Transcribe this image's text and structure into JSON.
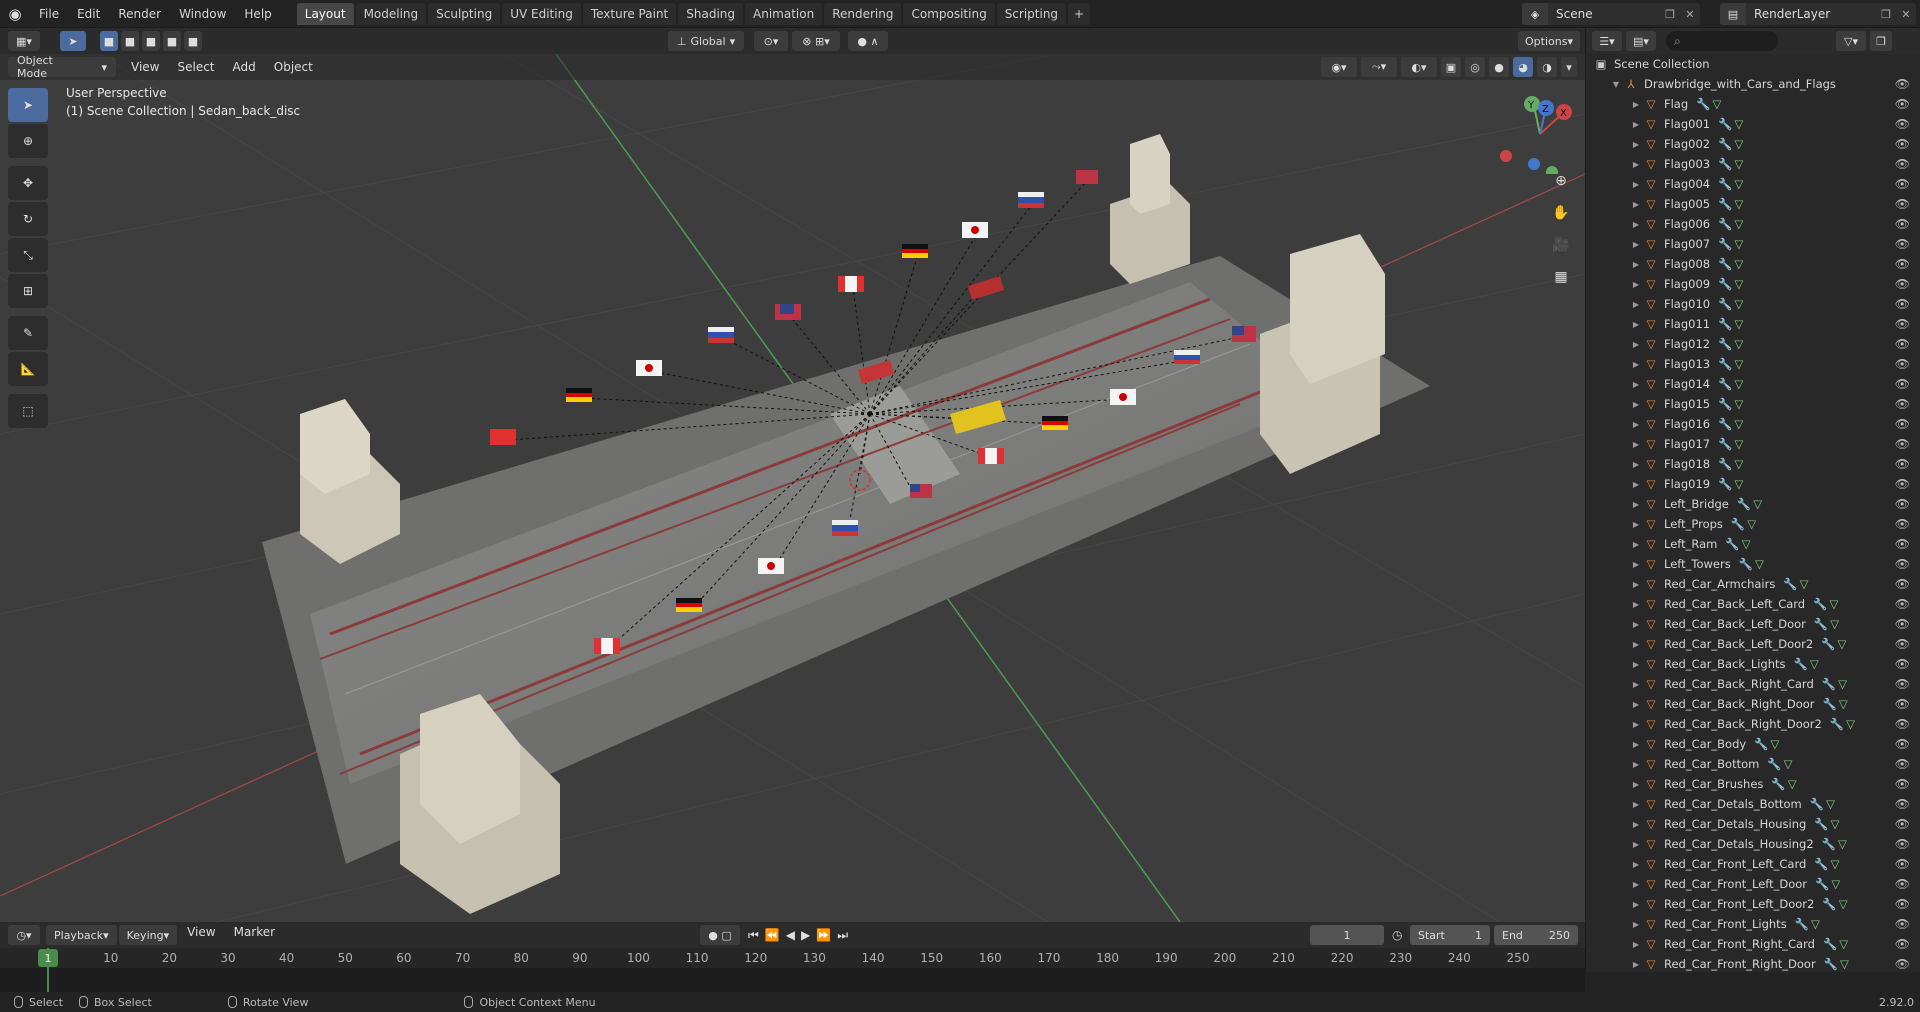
{
  "top_menu": {
    "items": [
      "File",
      "Edit",
      "Render",
      "Window",
      "Help"
    ]
  },
  "workspace_tabs": [
    {
      "label": "Layout",
      "active": true
    },
    {
      "label": "Modeling"
    },
    {
      "label": "Sculpting"
    },
    {
      "label": "UV Editing"
    },
    {
      "label": "Texture Paint"
    },
    {
      "label": "Shading"
    },
    {
      "label": "Animation"
    },
    {
      "label": "Rendering"
    },
    {
      "label": "Compositing"
    },
    {
      "label": "Scripting"
    }
  ],
  "scene": {
    "name": "Scene"
  },
  "render_layer": {
    "name": "RenderLayer"
  },
  "header": {
    "mode": "Object Mode",
    "menus": [
      "View",
      "Select",
      "Add",
      "Object"
    ],
    "transform_orientation": "Global",
    "options": "Options"
  },
  "viewport": {
    "perspective_label": "User Perspective",
    "collection_label": "(1) Scene Collection | Sedan_back_disc",
    "axis_x": "X",
    "axis_y": "Y",
    "axis_z": "Z"
  },
  "outliner": {
    "root": "Scene Collection",
    "collection": "Drawbridge_with_Cars_and_Flags",
    "objects": [
      "Flag",
      "Flag001",
      "Flag002",
      "Flag003",
      "Flag004",
      "Flag005",
      "Flag006",
      "Flag007",
      "Flag008",
      "Flag009",
      "Flag010",
      "Flag011",
      "Flag012",
      "Flag013",
      "Flag014",
      "Flag015",
      "Flag016",
      "Flag017",
      "Flag018",
      "Flag019",
      "Left_Bridge",
      "Left_Props",
      "Left_Ram",
      "Left_Towers",
      "Red_Car_Armchairs",
      "Red_Car_Back_Left_Card",
      "Red_Car_Back_Left_Door",
      "Red_Car_Back_Left_Door2",
      "Red_Car_Back_Lights",
      "Red_Car_Back_Right_Card",
      "Red_Car_Back_Right_Door",
      "Red_Car_Back_Right_Door2",
      "Red_Car_Body",
      "Red_Car_Bottom",
      "Red_Car_Brushes",
      "Red_Car_Detals_Bottom",
      "Red_Car_Detals_Housing",
      "Red_Car_Detals_Housing2",
      "Red_Car_Front_Left_Card",
      "Red_Car_Front_Left_Door",
      "Red_Car_Front_Left_Door2",
      "Red_Car_Front_Lights",
      "Red_Car_Front_Right_Card",
      "Red_Car_Front_Right_Door"
    ]
  },
  "timeline": {
    "menus": [
      "Playback",
      "Keying",
      "View",
      "Marker"
    ],
    "current_frame": "1",
    "start_label": "Start",
    "start": "1",
    "end_label": "End",
    "end": "250",
    "ticks": [
      "1",
      "10",
      "20",
      "30",
      "40",
      "50",
      "60",
      "70",
      "80",
      "90",
      "100",
      "110",
      "120",
      "130",
      "140",
      "150",
      "160",
      "170",
      "180",
      "190",
      "200",
      "210",
      "220",
      "230",
      "240",
      "250"
    ],
    "cursor_label": "1"
  },
  "status": {
    "select": "Select",
    "box_select": "Box Select",
    "rotate": "Rotate View",
    "context": "Object Context Menu",
    "version": "2.92.0"
  }
}
